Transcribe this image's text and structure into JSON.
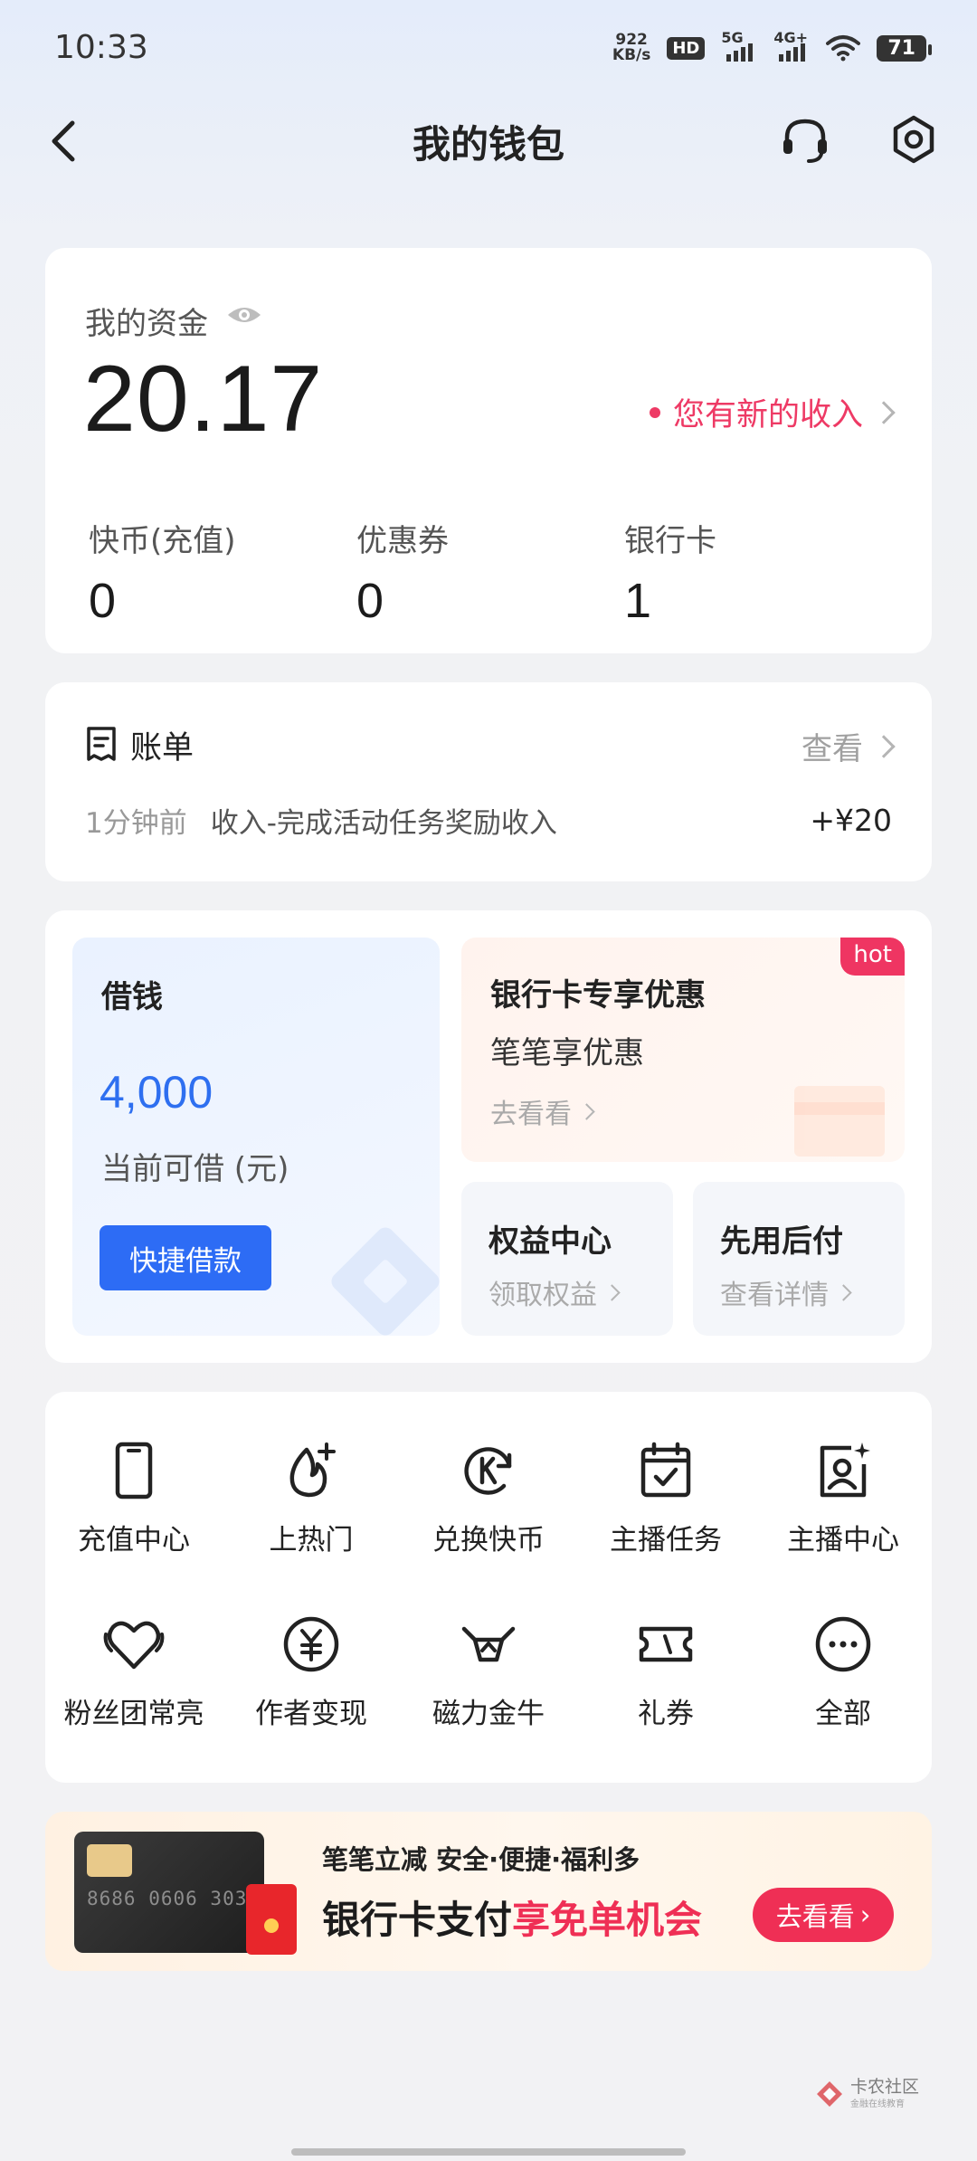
{
  "status_bar": {
    "time": "10:33",
    "net_speed_value": "922",
    "net_speed_unit": "KB/s",
    "hd_label": "HD",
    "signal1_label": "5G",
    "signal2_label": "4G+",
    "battery": "71"
  },
  "nav": {
    "title": "我的钱包"
  },
  "funds": {
    "label": "我的资金",
    "amount": "20.17",
    "income_notice": "您有新的收入",
    "stats": [
      {
        "label": "快币(充值)",
        "value": "0"
      },
      {
        "label": "优惠券",
        "value": "0"
      },
      {
        "label": "银行卡",
        "value": "1"
      }
    ]
  },
  "bill": {
    "title": "账单",
    "view_label": "查看",
    "latest": {
      "time": "1分钟前",
      "description": "收入-完成活动任务奖励收入",
      "amount": "+¥20"
    }
  },
  "finance": {
    "loan": {
      "title": "借钱",
      "amount": "4,000",
      "subtitle": "当前可借 (元)",
      "button": "快捷借款"
    },
    "promo": {
      "badge": "hot",
      "title": "银行卡专享优惠",
      "subtitle": "笔笔享优惠",
      "link": "去看看"
    },
    "benefits": {
      "title": "权益中心",
      "link": "领取权益"
    },
    "pay_later": {
      "title": "先用后付",
      "link": "查看详情"
    }
  },
  "services": [
    {
      "label": "充值中心",
      "icon": "phone-icon"
    },
    {
      "label": "上热门",
      "icon": "flame-plus-icon"
    },
    {
      "label": "兑换快币",
      "icon": "k-coin-exchange-icon"
    },
    {
      "label": "主播任务",
      "icon": "calendar-check-icon"
    },
    {
      "label": "主播中心",
      "icon": "profile-star-icon"
    },
    {
      "label": "粉丝团常亮",
      "icon": "heart-icon"
    },
    {
      "label": "作者变现",
      "icon": "yuan-icon"
    },
    {
      "label": "磁力金牛",
      "icon": "bull-icon"
    },
    {
      "label": "礼券",
      "icon": "ticket-icon"
    },
    {
      "label": "全部",
      "icon": "more-icon"
    }
  ],
  "banner": {
    "line1": "笔笔立减 安全·便捷·福利多",
    "line2_a": "银行卡支付",
    "line2_b": "享免单机会",
    "button": "去看看",
    "card_number": "8686 0606 303"
  },
  "watermark": {
    "text": "卡农社区",
    "sub": "金融在线教育"
  },
  "colors": {
    "accent_blue": "#2d6cf5",
    "accent_red": "#ef2f55",
    "income_red": "#ee3a65"
  }
}
